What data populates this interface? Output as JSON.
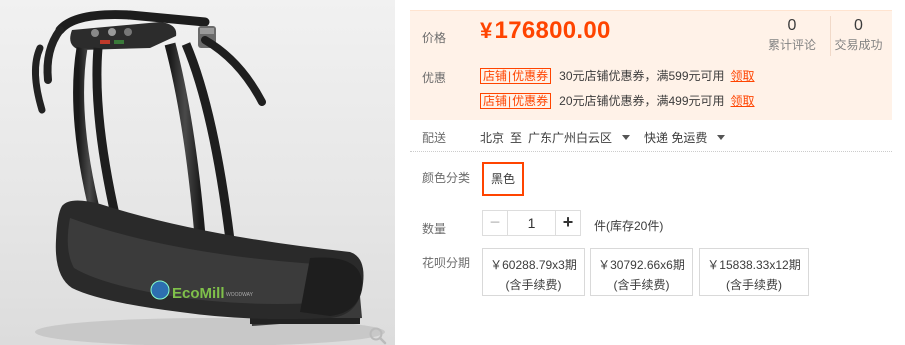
{
  "product_image": {
    "brand_text": "EcoMill",
    "model_text": "WOODWAY"
  },
  "price": {
    "label": "价格",
    "currency": "¥",
    "amount": "176800.00"
  },
  "stats": {
    "review_count": "0",
    "review_label": "累计评论",
    "trade_count": "0",
    "trade_label": "交易成功"
  },
  "promo": {
    "label": "优惠",
    "coupons": [
      {
        "tag_left": "店铺",
        "tag_right": "优惠券",
        "text": "30元店铺优惠券，满599元可用",
        "link": "领取"
      },
      {
        "tag_left": "店铺",
        "tag_right": "优惠券",
        "text": "20元店铺优惠券，满499元可用",
        "link": "领取"
      }
    ]
  },
  "shipping": {
    "label": "配送",
    "from": "北京",
    "to_word": "至",
    "destination": "广东广州白云区",
    "method": "快递 免运费"
  },
  "color": {
    "label": "颜色分类",
    "selected": "黑色"
  },
  "quantity": {
    "label": "数量",
    "minus": "−",
    "value": "1",
    "plus": "+",
    "stock_text": "件(库存20件)"
  },
  "installment": {
    "label": "花呗分期",
    "options": [
      {
        "price": "￥60288.79x3期",
        "note": "(含手续费)"
      },
      {
        "price": "￥30792.66x6期",
        "note": "(含手续费)"
      },
      {
        "price": "￥15838.33x12期",
        "note": "(含手续费)"
      }
    ]
  },
  "colors": {
    "accent": "#ff4400",
    "price_bg": "#fff2e8",
    "frame": "#2a2a2a"
  }
}
